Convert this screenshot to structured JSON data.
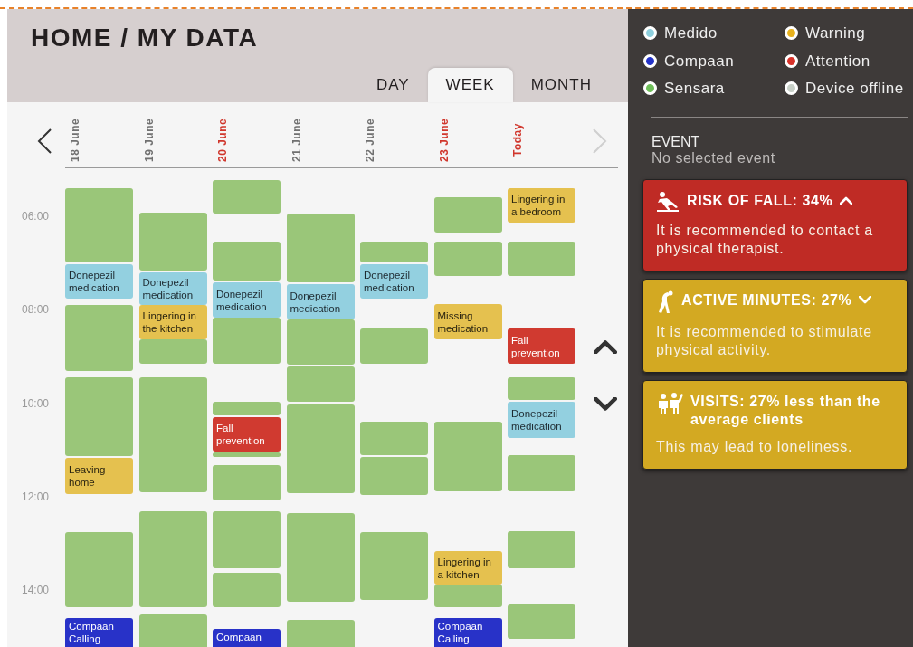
{
  "header": {
    "title": "HOME / MY DATA"
  },
  "tabs": [
    {
      "label": "DAY",
      "selected": false
    },
    {
      "label": "WEEK",
      "selected": true
    },
    {
      "label": "MONTH",
      "selected": false
    }
  ],
  "calendar": {
    "previous_disabled": false,
    "next_disabled": true,
    "days": [
      {
        "label": "18 June",
        "highlighted": false,
        "events": [
          {
            "kind": "sensara"
          },
          {
            "kind": "medido",
            "text": "Donepezil medication"
          },
          {
            "kind": "sensara"
          },
          {
            "kind": "sensara"
          },
          {
            "kind": "warning",
            "text": "Leaving home"
          },
          {
            "kind": "sensara"
          },
          {
            "kind": "compaan",
            "text": "Compaan Calling"
          }
        ]
      },
      {
        "label": "19 June",
        "highlighted": false,
        "events": [
          {
            "kind": "sensara"
          },
          {
            "kind": "medido",
            "text": "Donepezil medication"
          },
          {
            "kind": "warning",
            "text": "Lingering in the kitchen"
          },
          {
            "kind": "sensara"
          },
          {
            "kind": "sensara"
          },
          {
            "kind": "sensara"
          },
          {
            "kind": "sensara"
          }
        ]
      },
      {
        "label": "20 June",
        "highlighted": true,
        "events": [
          {
            "kind": "sensara"
          },
          {
            "kind": "sensara"
          },
          {
            "kind": "medido",
            "text": "Donepezil medication"
          },
          {
            "kind": "sensara"
          },
          {
            "kind": "sensara"
          },
          {
            "kind": "attention",
            "text": "Fall prevention"
          },
          {
            "kind": "sensara"
          },
          {
            "kind": "sensara"
          },
          {
            "kind": "sensara"
          },
          {
            "kind": "sensara"
          },
          {
            "kind": "compaan",
            "text": "Compaan"
          }
        ]
      },
      {
        "label": "21 June",
        "highlighted": false,
        "events": [
          {
            "kind": "sensara"
          },
          {
            "kind": "medido",
            "text": "Donepezil medication"
          },
          {
            "kind": "sensara"
          },
          {
            "kind": "sensara"
          },
          {
            "kind": "sensara"
          },
          {
            "kind": "sensara"
          },
          {
            "kind": "sensara"
          }
        ]
      },
      {
        "label": "22 June",
        "highlighted": false,
        "events": [
          {
            "kind": "sensara"
          },
          {
            "kind": "medido",
            "text": "Donepezil medication"
          },
          {
            "kind": "sensara"
          },
          {
            "kind": "sensara"
          },
          {
            "kind": "sensara"
          },
          {
            "kind": "sensara"
          }
        ]
      },
      {
        "label": "23 June",
        "highlighted": true,
        "events": [
          {
            "kind": "sensara"
          },
          {
            "kind": "sensara"
          },
          {
            "kind": "warning",
            "text": "Missing medication"
          },
          {
            "kind": "sensara"
          },
          {
            "kind": "warning",
            "text": "Lingering in a kitchen"
          },
          {
            "kind": "sensara"
          },
          {
            "kind": "compaan",
            "text": "Compaan Calling"
          }
        ]
      },
      {
        "label": "Today",
        "highlighted": true,
        "events": [
          {
            "kind": "warning",
            "text": "Lingering in a bedroom"
          },
          {
            "kind": "sensara"
          },
          {
            "kind": "attention",
            "text": "Fall prevention"
          },
          {
            "kind": "sensara"
          },
          {
            "kind": "medido",
            "text": "Donepezil medication"
          },
          {
            "kind": "sensara"
          },
          {
            "kind": "sensara"
          },
          {
            "kind": "sensara"
          }
        ]
      }
    ],
    "times": [
      "06:00",
      "08:00",
      "10:00",
      "12:00",
      "14:00"
    ]
  },
  "legend": [
    {
      "label": "Medido",
      "color": "#8fd0de"
    },
    {
      "label": "Warning",
      "color": "#e8b21e"
    },
    {
      "label": "Compaan",
      "color": "#2433c8"
    },
    {
      "label": "Attention",
      "color": "#d8322a"
    },
    {
      "label": "Sensara",
      "color": "#6fbf5a"
    },
    {
      "label": "Device offline",
      "color": "#c8d0c8"
    }
  ],
  "event_panel": {
    "heading": "EVENT",
    "status": "No selected event"
  },
  "cards": [
    {
      "kind": "attention",
      "title": "RISK OF FALL: 34%",
      "rising": true,
      "text": "It is recommended to contact a physical therapist."
    },
    {
      "kind": "warning",
      "title": "ACTIVE MINUTES: 27%",
      "rising": false,
      "text": "It is recommended to stimulate physical activity."
    },
    {
      "kind": "warning",
      "title": "VISITS: 27% less than the average clients",
      "text": "This may lead to loneliness."
    }
  ]
}
